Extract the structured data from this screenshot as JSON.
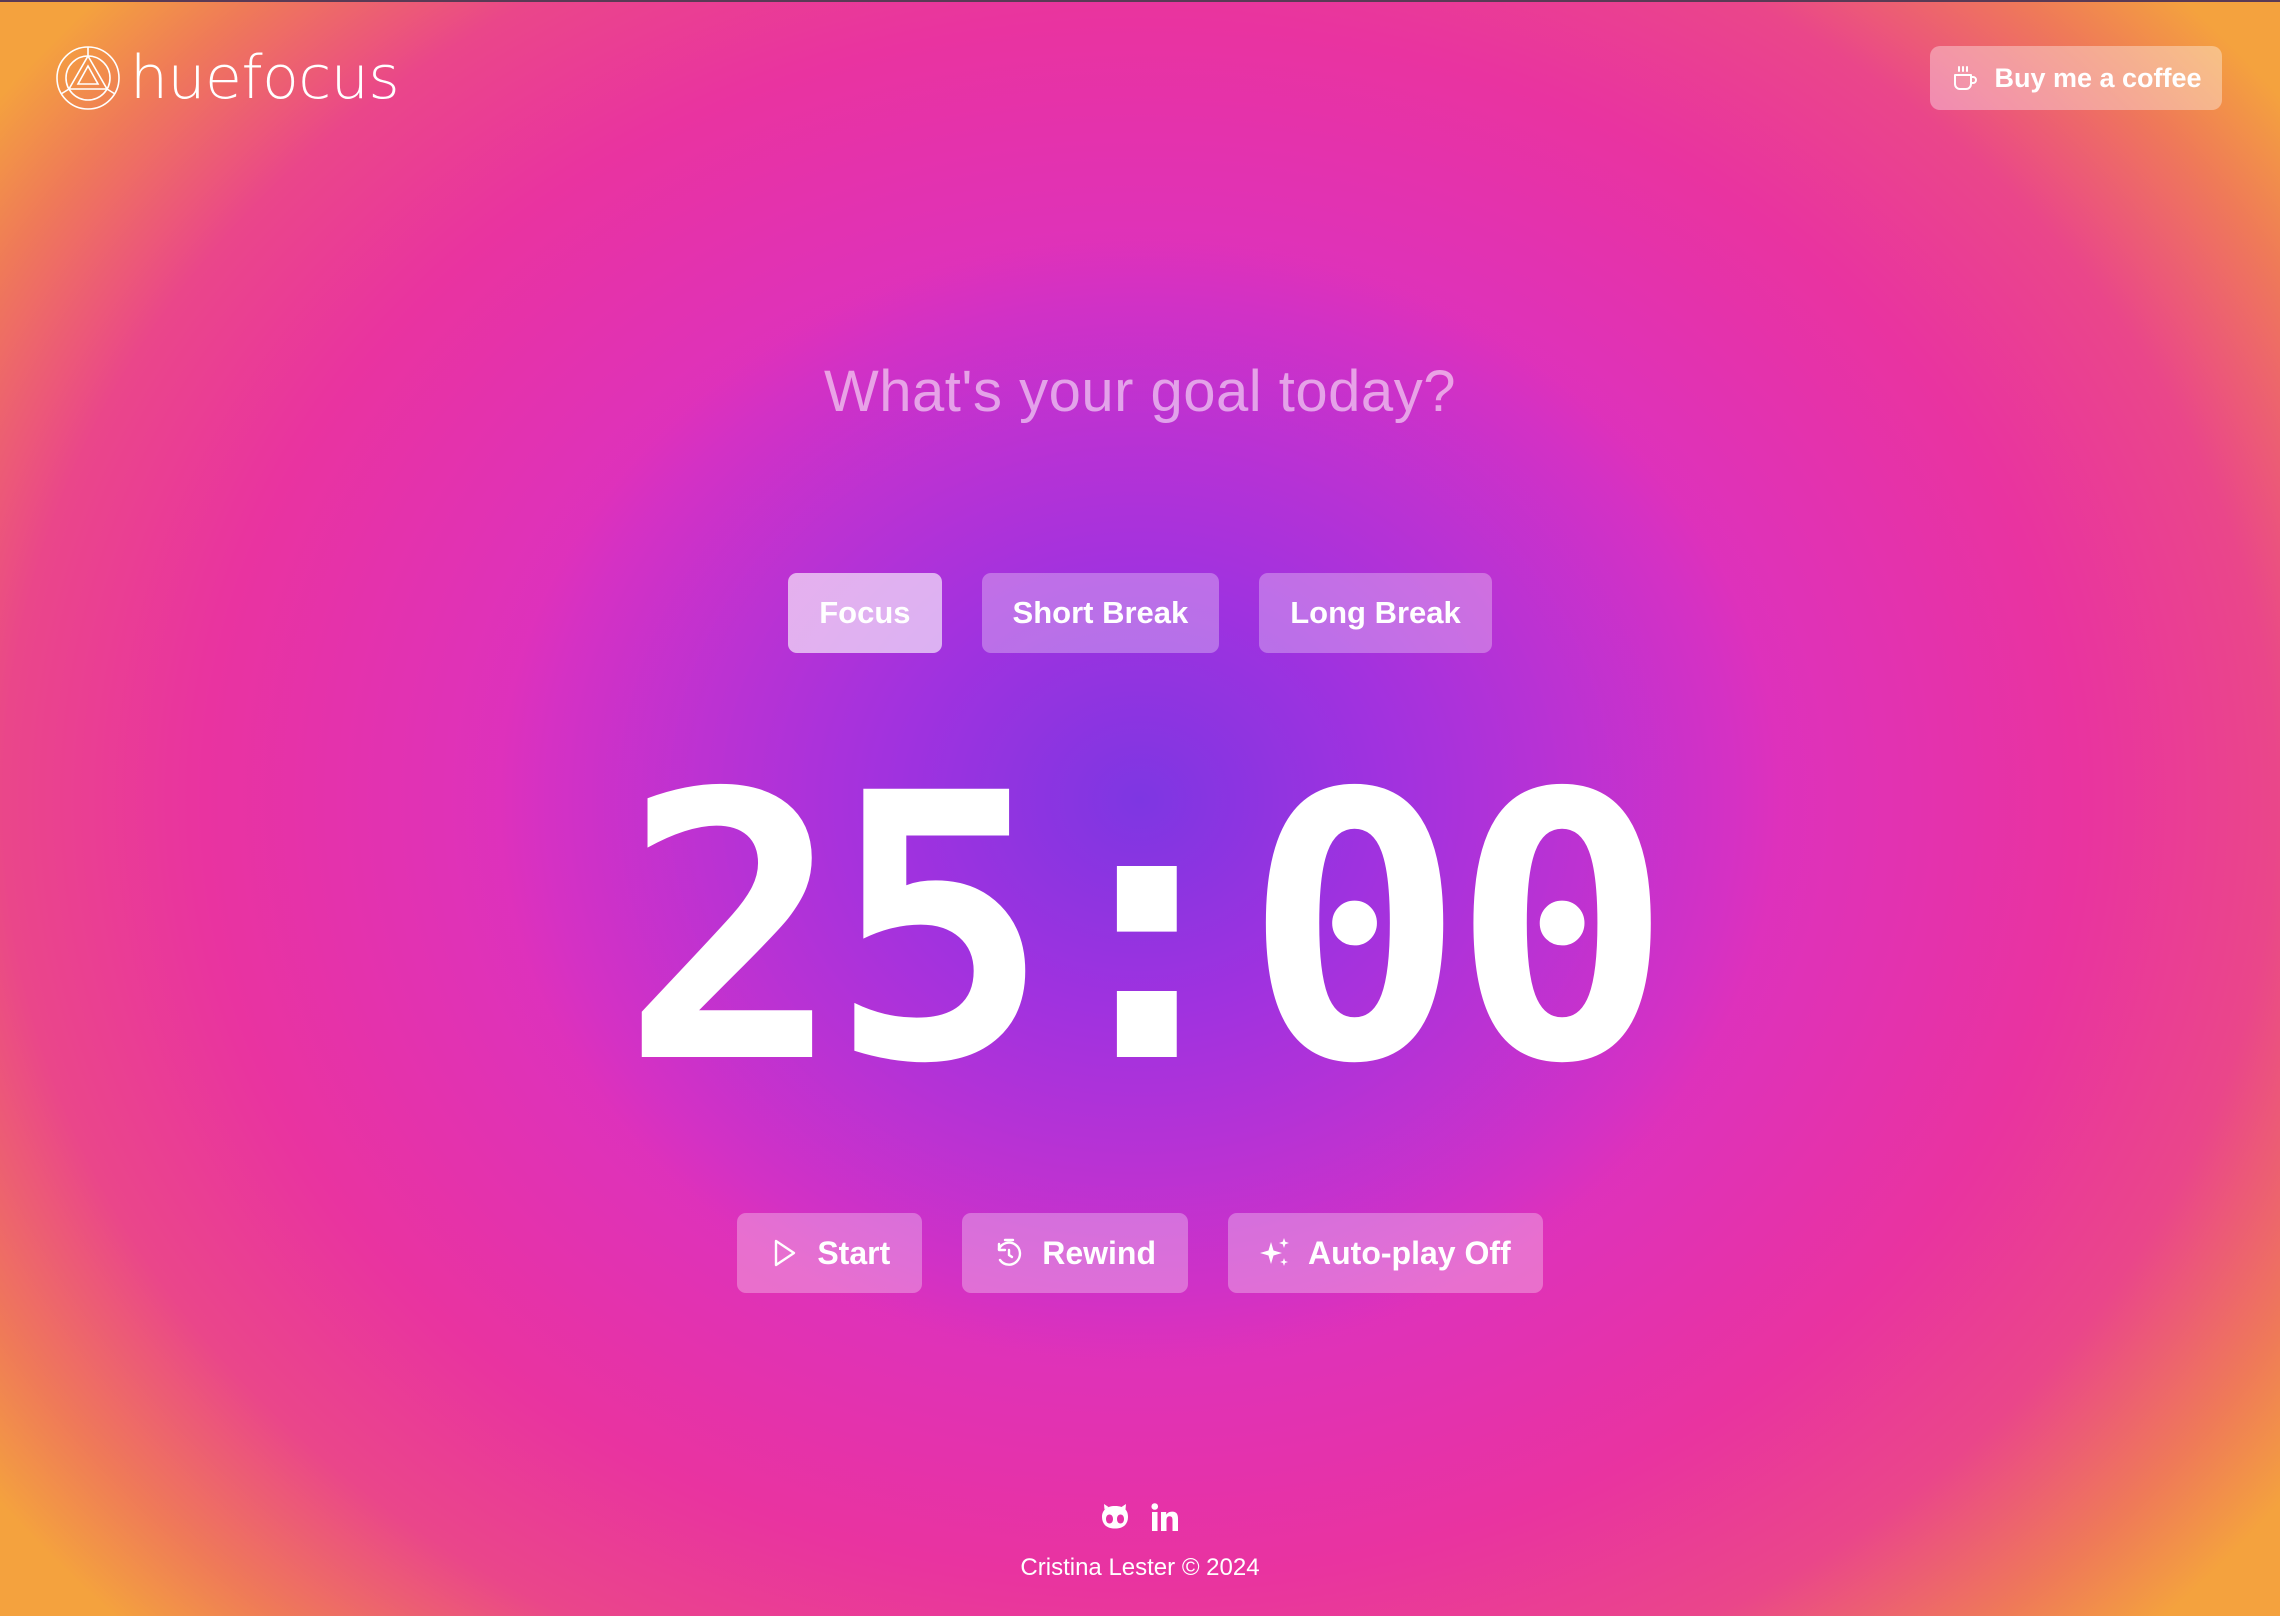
{
  "app": {
    "brand_name": "huefocus"
  },
  "header": {
    "coffee_button": {
      "label": "Buy me a coffee",
      "icon": "coffee-cup-icon"
    }
  },
  "goal": {
    "placeholder": "What's your goal today?",
    "value": ""
  },
  "modes": {
    "items": [
      {
        "label": "Focus",
        "active": true
      },
      {
        "label": "Short Break",
        "active": false
      },
      {
        "label": "Long Break",
        "active": false
      }
    ]
  },
  "timer": {
    "display": "25:00"
  },
  "controls": {
    "start": {
      "label": "Start",
      "icon": "play-icon"
    },
    "rewind": {
      "label": "Rewind",
      "icon": "rewind-timer-icon"
    },
    "autoplay": {
      "label": "Auto-play Off",
      "icon": "sparkles-icon"
    }
  },
  "footer": {
    "social": [
      {
        "icon": "github-icon"
      },
      {
        "icon": "linkedin-icon"
      }
    ],
    "credit": "Cristina Lester © 2024"
  },
  "colors": {
    "background_center": "#7e36e2",
    "background_mid": "#d033d2",
    "background_outer": "#e933a0",
    "background_corner": "#f4a23e",
    "text": "#ffffff"
  }
}
